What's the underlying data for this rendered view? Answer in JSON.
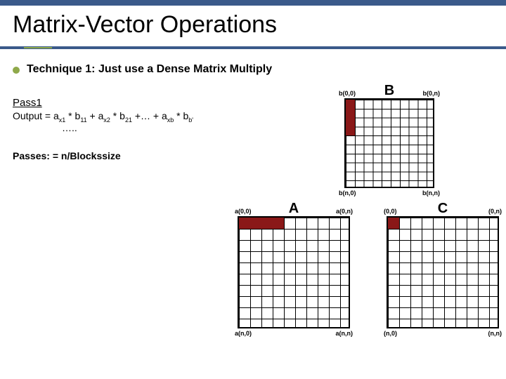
{
  "title": "Matrix-Vector Operations",
  "bullet1": "Technique 1: Just use a Dense Matrix Multiply",
  "pass_heading": "Pass1",
  "formula_prefix": "Output = a",
  "formula_s1": "x1",
  "formula_t1": " * b",
  "formula_s2": "11",
  "formula_t2": " + a",
  "formula_s3": "x2",
  "formula_t3": " * b",
  "formula_s4": "21",
  "formula_t4": " +… + a",
  "formula_s5": "xb",
  "formula_t5": " * b",
  "formula_s6": "b'",
  "dots": "…..",
  "passes_line": "Passes: = n/Blockssize",
  "figB": {
    "label": "B",
    "tl": "b(0,0)",
    "tr": "b(0,n)",
    "bl": "b(n,0)",
    "br": "b(n,n)"
  },
  "figA": {
    "label": "A",
    "tl": "a(0,0)",
    "tr": "a(0,n)",
    "bl": "a(n,0)",
    "br": "a(n,n)"
  },
  "figC": {
    "label": "C",
    "tl": "(0,0)",
    "tr": "(0,n)",
    "bl": "(n,0)",
    "br": "(n,n)"
  }
}
